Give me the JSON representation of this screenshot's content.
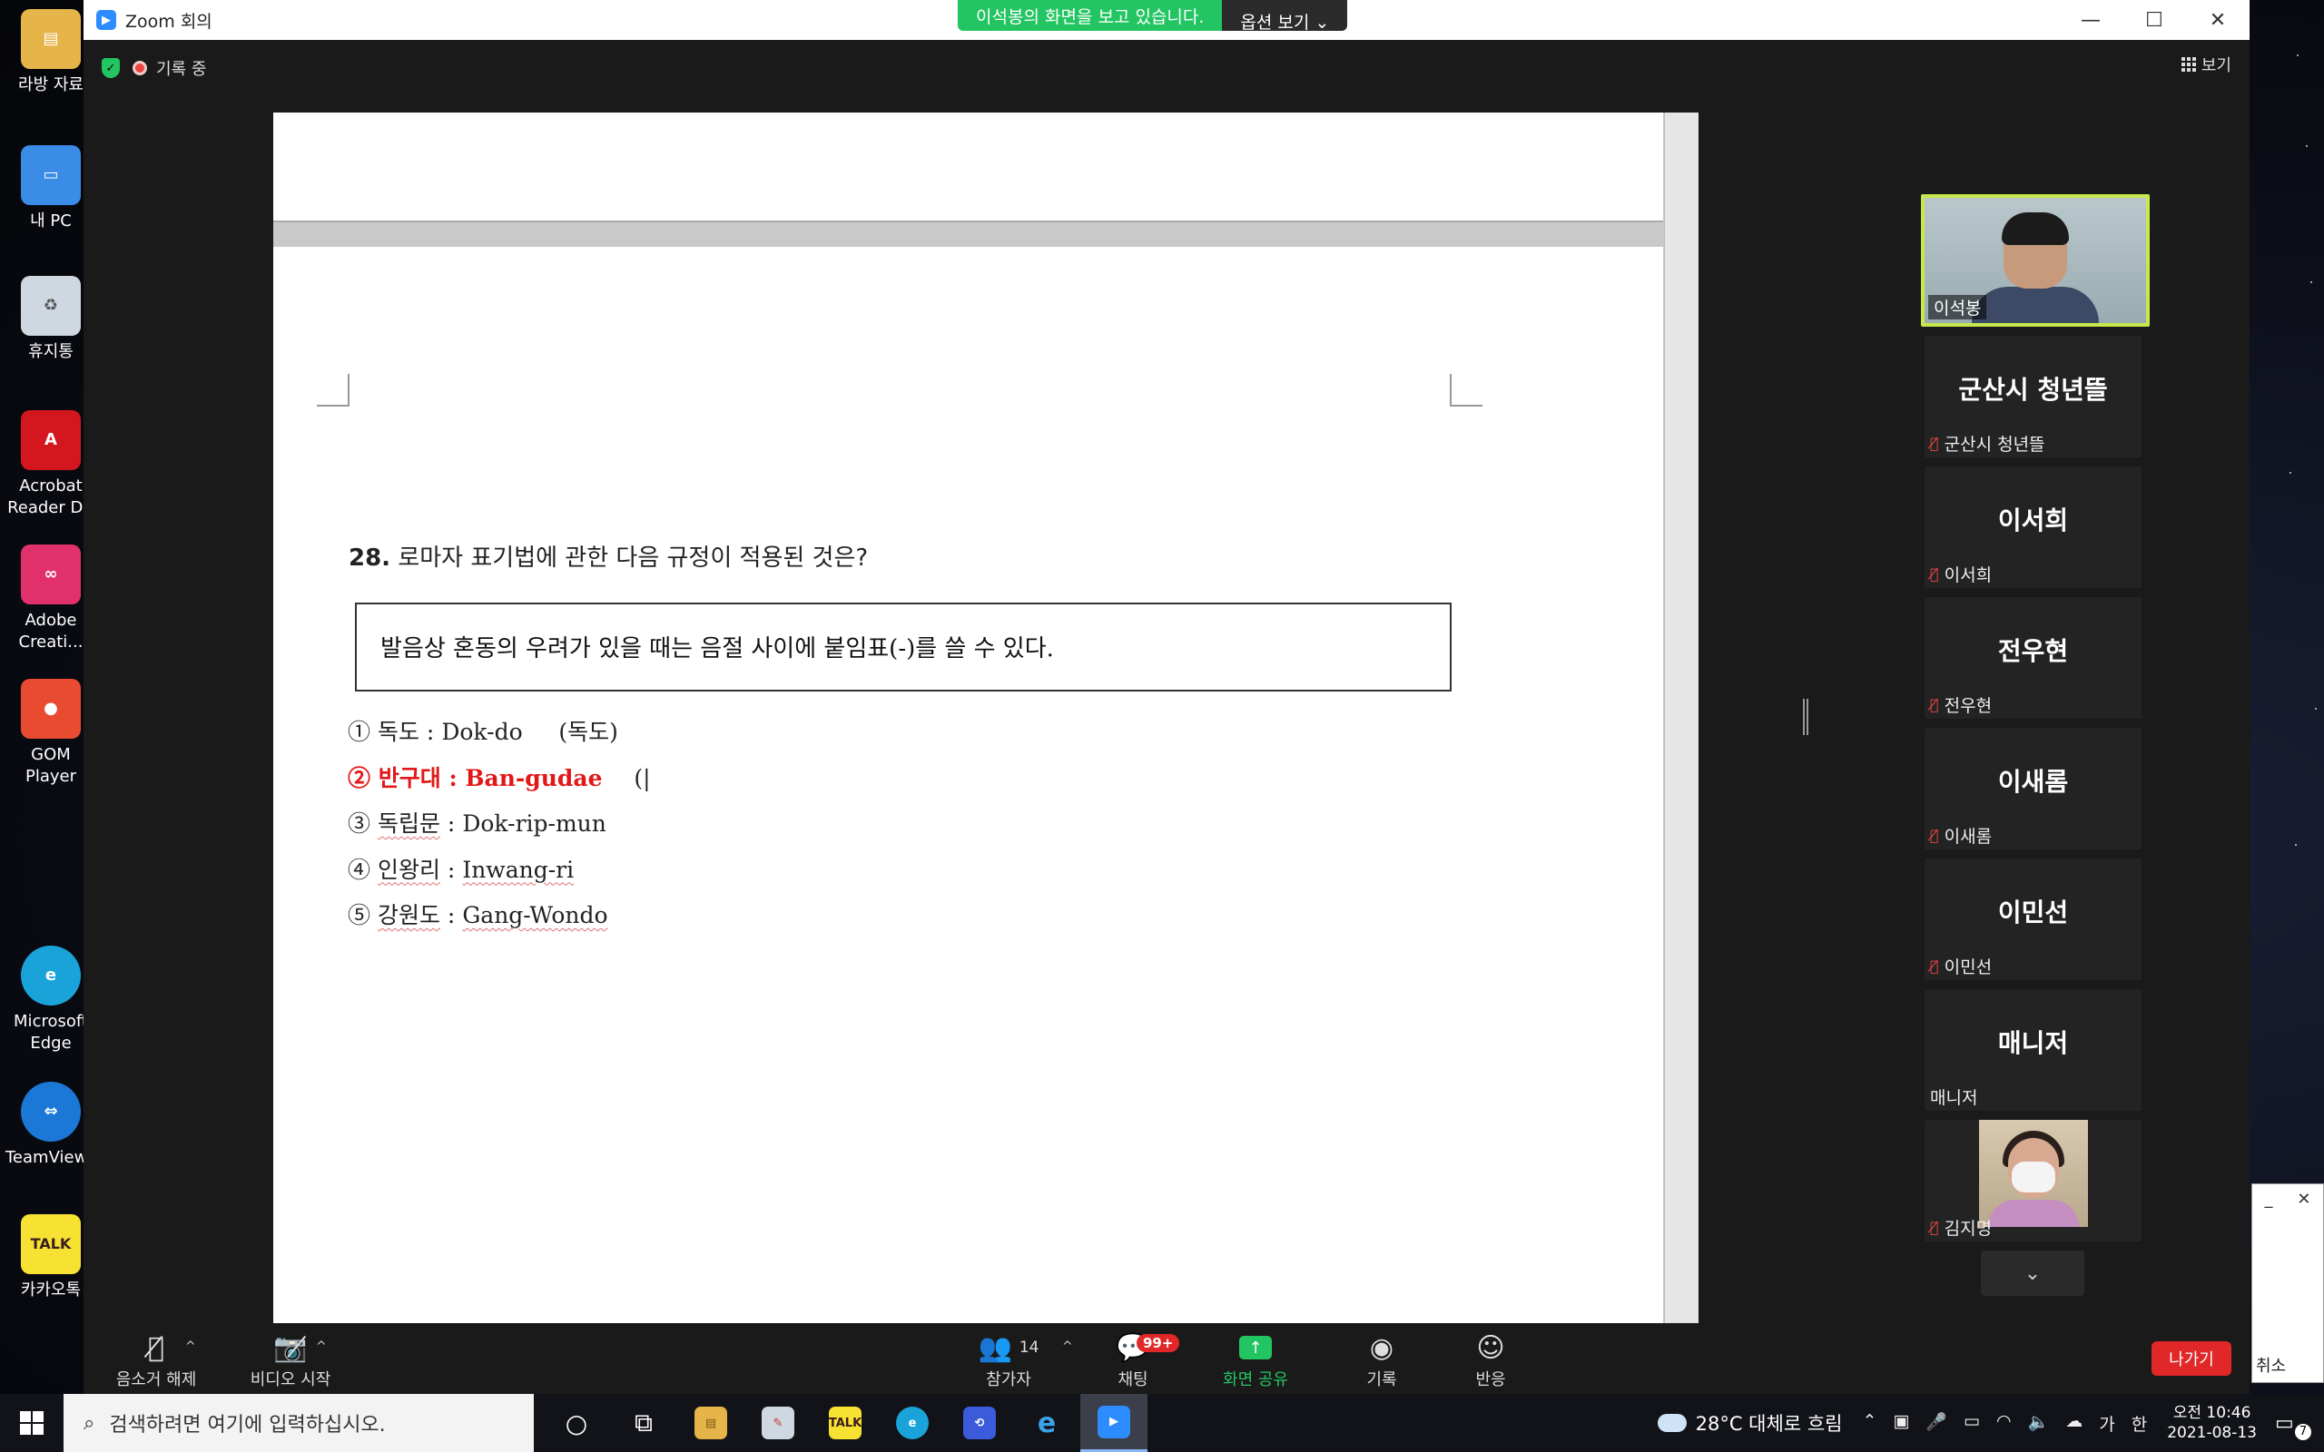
{
  "desktop": {
    "icons": [
      {
        "label": "라방 자료",
        "icon": "folder-icon",
        "color": "#e6b54a"
      },
      {
        "label": "내 PC",
        "icon": "computer-icon",
        "color": "#3b8ce6"
      },
      {
        "label": "휴지통",
        "icon": "recycle-bin-icon",
        "color": "#cfd8e0"
      },
      {
        "label": "Acrobat Reader DC",
        "icon": "acrobat-icon",
        "color": "#d4161f"
      },
      {
        "label": "Adobe Creati...",
        "icon": "creative-cloud-icon",
        "color": "#e0316c"
      },
      {
        "label": "GOM Player",
        "icon": "gom-player-icon",
        "color": "#e84b2f"
      },
      {
        "label": "Microsoft Edge",
        "icon": "edge-icon",
        "color": "#1aa3d8"
      },
      {
        "label": "TeamViewer",
        "icon": "teamviewer-icon",
        "color": "#1c78d6"
      },
      {
        "label": "카카오톡",
        "icon": "kakaotalk-icon",
        "color": "#f7e233"
      }
    ]
  },
  "zoom": {
    "window_title": "Zoom 회의",
    "share_banner": "이석봉의 화면을 보고 있습니다.",
    "options_label": "옵션 보기",
    "recording_label": "기록 중",
    "view_label": "보기",
    "document": {
      "question_number": "28.",
      "question_text": "로마자 표기법에 관한 다음 규정이 적용된 것은?",
      "rule_text": "발음상 혼동의 우려가 있을 때는 음절 사이에 붙임표(-)를 쓸 수 있다.",
      "options": [
        {
          "num": "①",
          "word": "독도",
          "roman": "Dok-do",
          "extra": "(독도)"
        },
        {
          "num": "②",
          "word": "반구대",
          "roman": "Ban-gudae",
          "extra": "(|"
        },
        {
          "num": "③",
          "word": "독립문",
          "roman": "Dok-rip-mun",
          "extra": ""
        },
        {
          "num": "④",
          "word": "인왕리",
          "roman": "Inwang-ri",
          "extra": ""
        },
        {
          "num": "⑤",
          "word": "강원도",
          "roman": "Gang-Wondo",
          "extra": ""
        }
      ]
    },
    "participants": {
      "host": {
        "name": "이석봉"
      },
      "tiles": [
        {
          "big": "군산시 청년뜰",
          "small": "군산시 청년뜰",
          "muted": true
        },
        {
          "big": "이서희",
          "small": "이서희",
          "muted": true
        },
        {
          "big": "전우현",
          "small": "전우현",
          "muted": true
        },
        {
          "big": "이새롬",
          "small": "이새롬",
          "muted": true
        },
        {
          "big": "이민선",
          "small": "이민선",
          "muted": true
        },
        {
          "big": "매니저",
          "small": "매니저",
          "muted": false
        }
      ],
      "last": {
        "name": "김지명",
        "muted": true
      }
    },
    "toolbar": {
      "unmute": "음소거 해제",
      "start_video": "비디오 시작",
      "participants": "참가자",
      "participants_count": "14",
      "chat": "채팅",
      "chat_badge": "99+",
      "share": "화면 공유",
      "record": "기록",
      "reactions": "반응",
      "leave": "나가기"
    }
  },
  "mini_window": {
    "cancel": "취소"
  },
  "taskbar": {
    "search_placeholder": "검색하려면 여기에 입력하십시오.",
    "weather": "28°C 대체로 흐림",
    "ime_lang": "가",
    "ime_mode": "한",
    "time": "오전 10:46",
    "date": "2021-08-13",
    "notification_count": "7"
  }
}
